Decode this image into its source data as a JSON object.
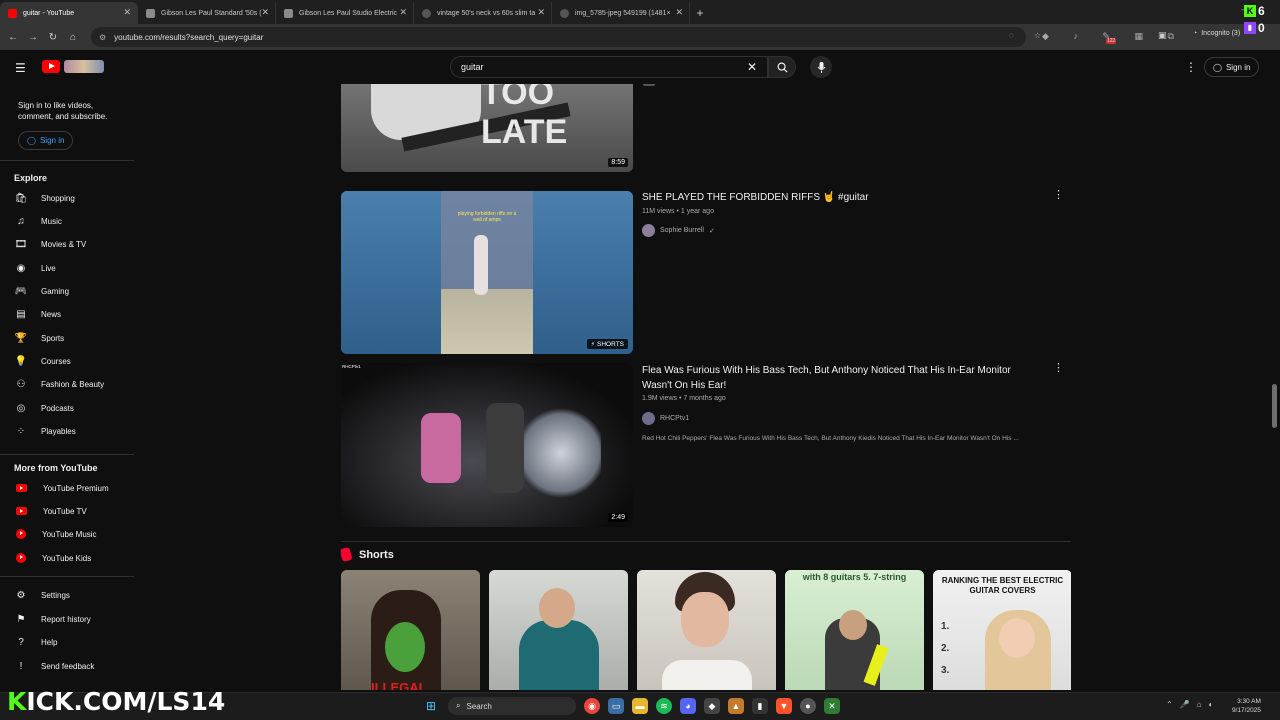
{
  "browser": {
    "tabs": [
      {
        "label": "guitar - YouTube",
        "color": "#ff0000",
        "active": true
      },
      {
        "label": "Gibson Les Paul Standard '50s (",
        "color": "#8a8a8a",
        "active": false
      },
      {
        "label": "Gibson Les Paul Studio Electric",
        "color": "#8a8a8a",
        "active": false
      },
      {
        "label": "vintage 50's neck vs 60s slim ta",
        "color": "#aaaaaa",
        "active": false
      },
      {
        "label": "img_5785-jpeg 549199 (1481×",
        "color": "#aaaaaa",
        "active": false
      }
    ],
    "new_tab": "+",
    "url": "youtube.com/results?search_query=guitar",
    "incognito_label": "Incognito (3)",
    "ext_badge": "122"
  },
  "header": {
    "search_value": "guitar",
    "sign_in": "Sign in"
  },
  "sidebar": {
    "note": "Sign in to like videos, comment, and subscribe.",
    "sign_in": "Sign in",
    "explore_title": "Explore",
    "explore": [
      {
        "label": "Shopping",
        "icon": "shopping-bag-icon",
        "glyph": "🛍"
      },
      {
        "label": "Music",
        "icon": "music-note-icon",
        "glyph": "♫"
      },
      {
        "label": "Movies & TV",
        "icon": "film-icon",
        "glyph": "🎞"
      },
      {
        "label": "Live",
        "icon": "live-icon",
        "glyph": "◉"
      },
      {
        "label": "Gaming",
        "icon": "gamepad-icon",
        "glyph": "🎮"
      },
      {
        "label": "News",
        "icon": "newspaper-icon",
        "glyph": "▤"
      },
      {
        "label": "Sports",
        "icon": "trophy-icon",
        "glyph": "🏆"
      },
      {
        "label": "Courses",
        "icon": "lightbulb-icon",
        "glyph": "💡"
      },
      {
        "label": "Fashion & Beauty",
        "icon": "hanger-icon",
        "glyph": "⚇"
      },
      {
        "label": "Podcasts",
        "icon": "podcast-icon",
        "glyph": "◎"
      },
      {
        "label": "Playables",
        "icon": "playables-icon",
        "glyph": "⁘"
      }
    ],
    "more_title": "More from YouTube",
    "more": [
      {
        "label": "YouTube Premium",
        "icon": "youtube-premium-icon"
      },
      {
        "label": "YouTube TV",
        "icon": "youtube-tv-icon"
      },
      {
        "label": "YouTube Music",
        "icon": "youtube-music-icon"
      },
      {
        "label": "YouTube Kids",
        "icon": "youtube-kids-icon"
      }
    ],
    "footer": [
      {
        "label": "Settings",
        "icon": "gear-icon",
        "glyph": "⚙"
      },
      {
        "label": "Report history",
        "icon": "flag-icon",
        "glyph": "⚑"
      },
      {
        "label": "Help",
        "icon": "help-icon",
        "glyph": "?"
      },
      {
        "label": "Send feedback",
        "icon": "feedback-icon",
        "glyph": "!"
      }
    ]
  },
  "results": {
    "video0": {
      "duration": "8:59",
      "thumb_text": "TOO LATE"
    },
    "video1": {
      "title": "SHE PLAYED THE FORBIDDEN RIFFS 🤘 #guitar",
      "meta": "11M views • 1 year ago",
      "channel": "Sophie Burrell",
      "verified": "✓",
      "tag": "SHORTS",
      "thumb_caption": "playing forbidden riffs on a wall of amps"
    },
    "video2": {
      "title": "Flea Was Furious With His Bass Tech, But Anthony Noticed That His In-Ear Monitor Wasn't On His Ear!",
      "meta": "1.9M views • 7 months ago",
      "channel": "RHCPtv1",
      "description": "Red Hot Chili Peppers' Flea Was Furious With His Bass Tech, But Anthony Kiedis Noticed That His In-Ear Monitor Wasn't On His ...",
      "duration": "2:49",
      "thumb_label": "RHCPtv1"
    },
    "shorts_title": "Shorts",
    "shorts": [
      {
        "caption": "ILLEGAL",
        "bg": "#9a8f7c"
      },
      {
        "caption": "",
        "bg": "#c9ccc8"
      },
      {
        "caption": "",
        "bg": "#d9d6d0"
      },
      {
        "caption": "with 8 guitars 5. 7-string",
        "bg": "#cfe6c9"
      },
      {
        "caption": "RANKING THE BEST ELECTRIC GUITAR COVERS",
        "bg": "#eeeeee"
      }
    ]
  },
  "overlay": {
    "kick_prefix": "K",
    "kick_rest": "ICK.COM/LS14",
    "kick_count": "6",
    "twitch_count": "0"
  },
  "taskbar": {
    "search": "Search",
    "time": "3:30 AM",
    "date": "9/17/2025"
  }
}
